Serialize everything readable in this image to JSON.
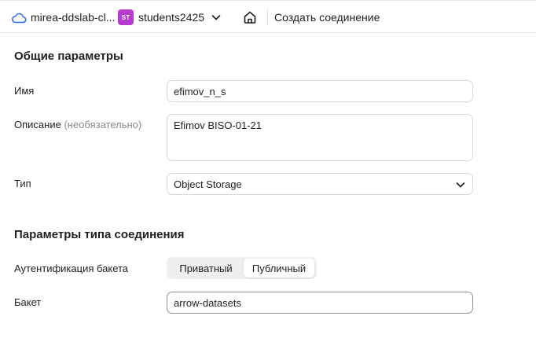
{
  "header": {
    "cloud_name": "mirea-ddslab-cl...",
    "folder_badge": "ST",
    "folder_name": "students2425",
    "breadcrumb": "Создать соединение"
  },
  "general": {
    "title": "Общие параметры",
    "name_label": "Имя",
    "name_value": "efimov_n_s",
    "description_label": "Описание",
    "description_optional": "(необязательно)",
    "description_value": "Efimov BISO-01-21",
    "type_label": "Тип",
    "type_value": "Object Storage"
  },
  "connection": {
    "title": "Параметры типа соединения",
    "auth_label": "Аутентификация бакета",
    "auth_options": [
      "Приватный",
      "Публичный"
    ],
    "auth_selected": "Публичный",
    "bucket_label": "Бакет",
    "bucket_value": "arrow-datasets"
  },
  "colors": {
    "badge": "#b93ad1",
    "cloud_icon": "#2e6ef5"
  }
}
